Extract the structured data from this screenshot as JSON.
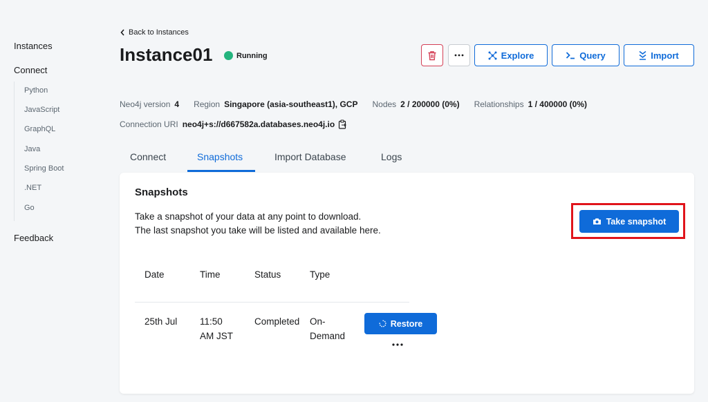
{
  "sidebar": {
    "instances": "Instances",
    "connect": "Connect",
    "sub_items": [
      "Python",
      "JavaScript",
      "GraphQL",
      "Java",
      "Spring Boot",
      ".NET",
      "Go"
    ],
    "feedback": "Feedback"
  },
  "header": {
    "back_label": "Back to Instances",
    "title": "Instance01",
    "status": "Running",
    "explore_label": "Explore",
    "query_label": "Query",
    "import_label": "Import"
  },
  "meta": {
    "version_label": "Neo4j version",
    "version": "4",
    "region_label": "Region",
    "region": "Singapore (asia-southeast1), GCP",
    "nodes_label": "Nodes",
    "nodes": "2 / 200000 (0%)",
    "relationships_label": "Relationships",
    "relationships": "1 / 400000 (0%)",
    "uri_label": "Connection URI",
    "uri": "neo4j+s://d667582a.databases.neo4j.io"
  },
  "tabs": [
    "Connect",
    "Snapshots",
    "Import Database",
    "Logs"
  ],
  "snapshots": {
    "heading": "Snapshots",
    "desc_line1": "Take a snapshot of your data at any point to download.",
    "desc_line2": "The last snapshot you take will be listed and available here.",
    "take_label": "Take snapshot",
    "columns": [
      "Date",
      "Time",
      "Status",
      "Type"
    ],
    "row": {
      "date": "25th Jul",
      "time_line1": "11:50",
      "time_line2": "AM JST",
      "status": "Completed",
      "type_line1": "On-",
      "type_line2": "Demand",
      "restore_label": "Restore"
    }
  },
  "colors": {
    "accent": "#0f6bd9",
    "running": "#24b47e",
    "danger": "#d43f55",
    "highlight": "#e0141b"
  }
}
